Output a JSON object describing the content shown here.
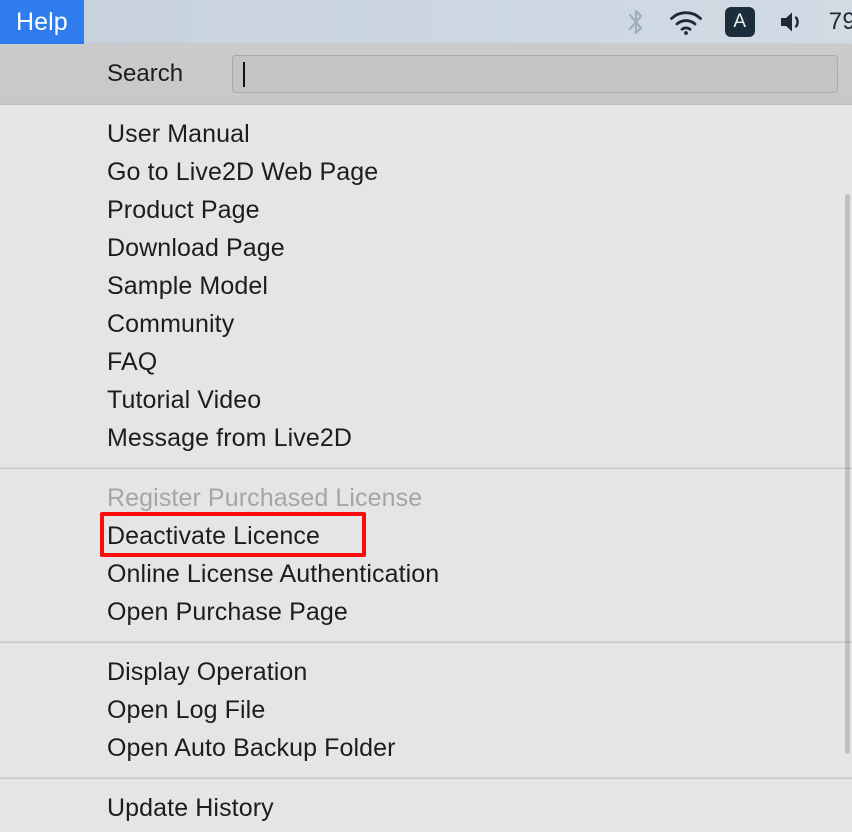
{
  "menubar": {
    "active_menu_label": "Help",
    "accent_color": "#2e7ced",
    "status_items": [
      {
        "name": "bluetooth-icon",
        "label": "Bluetooth",
        "state": "disabled"
      },
      {
        "name": "wifi-icon",
        "label": "Wi-Fi",
        "state": "connected"
      },
      {
        "name": "input-source-badge",
        "label": "A"
      },
      {
        "name": "volume-icon",
        "label": "Volume"
      },
      {
        "name": "battery-percent",
        "label": "79"
      }
    ],
    "battery_text": "79",
    "input_source_text": "A"
  },
  "search": {
    "label": "Search",
    "value": "",
    "placeholder": ""
  },
  "menu": {
    "groups": [
      {
        "items": [
          {
            "label": "User Manual",
            "enabled": true
          },
          {
            "label": "Go to Live2D Web Page",
            "enabled": true
          },
          {
            "label": "Product Page",
            "enabled": true
          },
          {
            "label": "Download Page",
            "enabled": true
          },
          {
            "label": "Sample Model",
            "enabled": true
          },
          {
            "label": "Community",
            "enabled": true
          },
          {
            "label": "FAQ",
            "enabled": true
          },
          {
            "label": "Tutorial Video",
            "enabled": true
          },
          {
            "label": "Message from Live2D",
            "enabled": true
          }
        ]
      },
      {
        "items": [
          {
            "label": "Register Purchased License",
            "enabled": false
          },
          {
            "label": "Deactivate Licence",
            "enabled": true,
            "highlighted": true
          },
          {
            "label": "Online License Authentication",
            "enabled": true
          },
          {
            "label": "Open Purchase Page",
            "enabled": true
          }
        ]
      },
      {
        "items": [
          {
            "label": "Display Operation",
            "enabled": true
          },
          {
            "label": "Open Log File",
            "enabled": true
          },
          {
            "label": "Open Auto Backup Folder",
            "enabled": true
          }
        ]
      },
      {
        "items": [
          {
            "label": "Update History",
            "enabled": true
          }
        ]
      }
    ],
    "highlight_color": "#fb0b0b"
  }
}
